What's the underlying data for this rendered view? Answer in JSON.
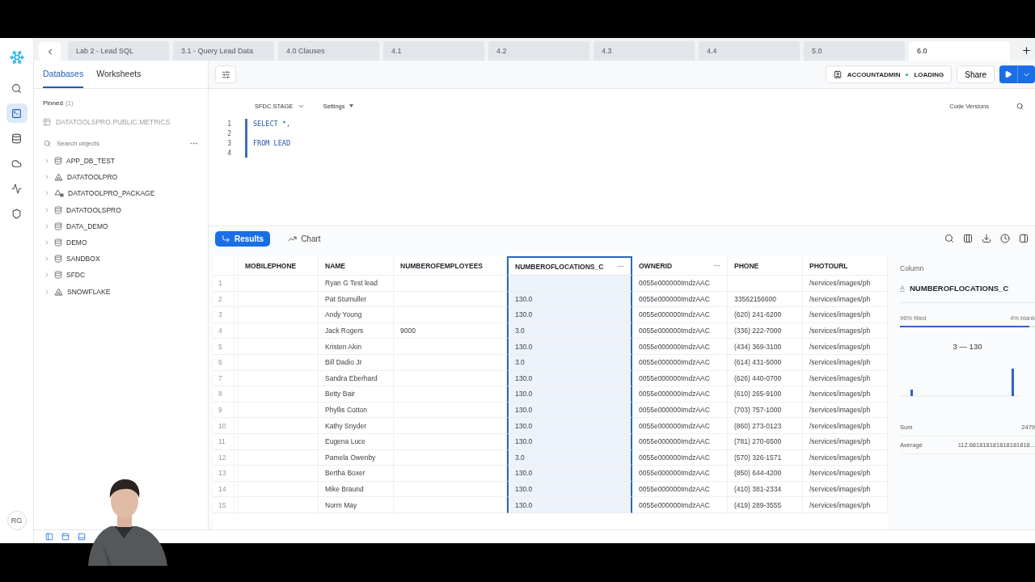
{
  "rail": {
    "items": [
      {
        "kind": "search",
        "selected": false
      },
      {
        "kind": "worksheets",
        "selected": true
      },
      {
        "kind": "data",
        "selected": false
      },
      {
        "kind": "cloud",
        "selected": false
      },
      {
        "kind": "activity",
        "selected": false
      },
      {
        "kind": "admin",
        "selected": false
      }
    ],
    "avatar": "RG"
  },
  "tabs": [
    {
      "label": "Lab 2 - Lead SQL",
      "selected": false
    },
    {
      "label": "3.1 - Query Lead Data",
      "selected": false
    },
    {
      "label": "4.0 Clauses",
      "selected": false
    },
    {
      "label": "4.1",
      "selected": false
    },
    {
      "label": "4.2",
      "selected": false
    },
    {
      "label": "4.3",
      "selected": false
    },
    {
      "label": "4.4",
      "selected": false
    },
    {
      "label": "5.0",
      "selected": false
    },
    {
      "label": "6.0",
      "selected": true
    }
  ],
  "sidebar": {
    "tabs": [
      {
        "label": "Databases",
        "selected": true
      },
      {
        "label": "Worksheets",
        "selected": false
      }
    ],
    "pinned_label": "Pinned",
    "pinned_count": "(1)",
    "pinned_items": [
      "DATATOOLSPRO.PUBLIC.METRICS"
    ],
    "search": {
      "placeholder": "Search objects"
    },
    "tree": [
      {
        "label": "APP_DB_TEST",
        "kind": "database",
        "expanded": false
      },
      {
        "label": "DATATOOLPRO",
        "kind": "shared",
        "expanded": false
      },
      {
        "label": "DATATOOLPRO_PACKAGE",
        "kind": "package",
        "expanded": false
      },
      {
        "label": "DATATOOLSPRO",
        "kind": "database",
        "expanded": false
      },
      {
        "label": "DATA_DEMO",
        "kind": "database",
        "expanded": false
      },
      {
        "label": "DEMO",
        "kind": "database",
        "expanded": false
      },
      {
        "label": "SANDBOX",
        "kind": "database",
        "expanded": false
      },
      {
        "label": "SFDC",
        "kind": "database",
        "expanded": false
      },
      {
        "label": "SNOWFLAKE",
        "kind": "shared",
        "expanded": false
      }
    ]
  },
  "toolbar": {
    "role": "ACCOUNTADMIN",
    "warehouse": "LOADING",
    "share": "Share"
  },
  "editor": {
    "context": "SFDC.STAGE",
    "settings": "Settings",
    "code_versions": "Code Versions",
    "lines": [
      {
        "number": "1",
        "code": "SELECT *,"
      },
      {
        "number": "2"
      },
      {
        "number": "3",
        "code": "FROM LEAD"
      },
      {
        "number": "4"
      }
    ]
  },
  "results": {
    "tabs": [
      {
        "label": "Results",
        "selected": true
      },
      {
        "label": "Chart",
        "selected": false
      }
    ],
    "columns": [
      {
        "label": "MOBILEPHONE",
        "selected": false,
        "menu": false
      },
      {
        "label": "NAME",
        "selected": false,
        "menu": false
      },
      {
        "label": "NUMBEROFEMPLOYEES",
        "selected": false,
        "menu": false
      },
      {
        "label": "NUMBEROFLOCATIONS_C",
        "selected": true,
        "menu": true
      },
      {
        "label": "OWNERID",
        "selected": false,
        "menu": true
      },
      {
        "label": "PHONE",
        "selected": false,
        "menu": false
      },
      {
        "label": "PHOTOURL",
        "selected": false,
        "menu": false
      }
    ],
    "rows": [
      {
        "number": "1",
        "cells": [
          null,
          "Ryan G Test lead",
          null,
          null,
          "0055e000000ImdzAAC",
          null,
          "/services/images/ph"
        ]
      },
      {
        "number": "2",
        "cells": [
          null,
          "Pat Stumuller",
          null,
          "130.0",
          "0055e000000ImdzAAC",
          "33562156600",
          "/services/images/ph"
        ]
      },
      {
        "number": "3",
        "cells": [
          null,
          "Andy Young",
          null,
          "130.0",
          "0055e000000ImdzAAC",
          "(620) 241-6200",
          "/services/images/ph"
        ]
      },
      {
        "number": "4",
        "cells": [
          null,
          "Jack Rogers",
          "9000",
          "3.0",
          "0055e000000ImdzAAC",
          "(336) 222-7000",
          "/services/images/ph"
        ]
      },
      {
        "number": "5",
        "cells": [
          null,
          "Kristen Akin",
          null,
          "130.0",
          "0055e000000ImdzAAC",
          "(434) 369-3100",
          "/services/images/ph"
        ]
      },
      {
        "number": "6",
        "cells": [
          null,
          "Bill Dadio Jr",
          null,
          "3.0",
          "0055e000000ImdzAAC",
          "(614) 431-5000",
          "/services/images/ph"
        ]
      },
      {
        "number": "7",
        "cells": [
          null,
          "Sandra Eberhard",
          null,
          "130.0",
          "0055e000000ImdzAAC",
          "(626) 440-0700",
          "/services/images/ph"
        ]
      },
      {
        "number": "8",
        "cells": [
          null,
          "Betty Bair",
          null,
          "130.0",
          "0055e000000ImdzAAC",
          "(610) 265-9100",
          "/services/images/ph"
        ]
      },
      {
        "number": "9",
        "cells": [
          null,
          "Phyllis Cotton",
          null,
          "130.0",
          "0055e000000ImdzAAC",
          "(703) 757-1000",
          "/services/images/ph"
        ]
      },
      {
        "number": "10",
        "cells": [
          null,
          "Kathy Snyder",
          null,
          "130.0",
          "0055e000000ImdzAAC",
          "(860) 273-0123",
          "/services/images/ph"
        ]
      },
      {
        "number": "11",
        "cells": [
          null,
          "Eugena Luce",
          null,
          "130.0",
          "0055e000000ImdzAAC",
          "(781) 270-6500",
          "/services/images/ph"
        ]
      },
      {
        "number": "12",
        "cells": [
          null,
          "Pamela Owenby",
          null,
          "3.0",
          "0055e000000ImdzAAC",
          "(570) 326-1571",
          "/services/images/ph"
        ]
      },
      {
        "number": "13",
        "cells": [
          null,
          "Bertha Boxer",
          null,
          "130.0",
          "0055e000000ImdzAAC",
          "(850) 644-4200",
          "/services/images/ph"
        ]
      },
      {
        "number": "14",
        "cells": [
          null,
          "Mike Braund",
          null,
          "130.0",
          "0055e000000ImdzAAC",
          "(410) 381-2334",
          "/services/images/ph"
        ]
      },
      {
        "number": "15",
        "cells": [
          null,
          "Norm May",
          null,
          "130.0",
          "0055e000000ImdzAAC",
          "(419) 289-3555",
          "/services/images/ph"
        ]
      }
    ]
  },
  "column_panel": {
    "heading": "Column",
    "name": "NUMBEROFLOCATIONS_C",
    "filled": "96% filled",
    "blank": "4% blank",
    "level": 0.96,
    "range": "3 — 130",
    "stats": [
      {
        "label": "Sum",
        "value": "2479"
      },
      {
        "label": "Average",
        "value": "112.681818181818181818..."
      }
    ]
  }
}
